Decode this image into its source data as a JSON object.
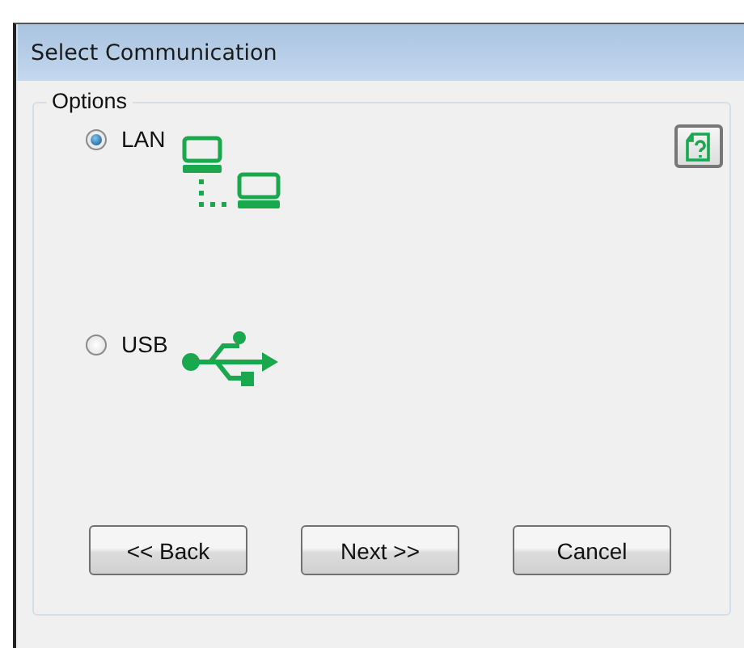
{
  "window": {
    "title": "Select Communication"
  },
  "group": {
    "label": "Options"
  },
  "options": [
    {
      "kind": "lan",
      "label": "LAN",
      "selected": true
    },
    {
      "kind": "usb",
      "label": "USB",
      "selected": false
    }
  ],
  "buttons": [
    "<< Back",
    "Next >>",
    "Cancel"
  ]
}
